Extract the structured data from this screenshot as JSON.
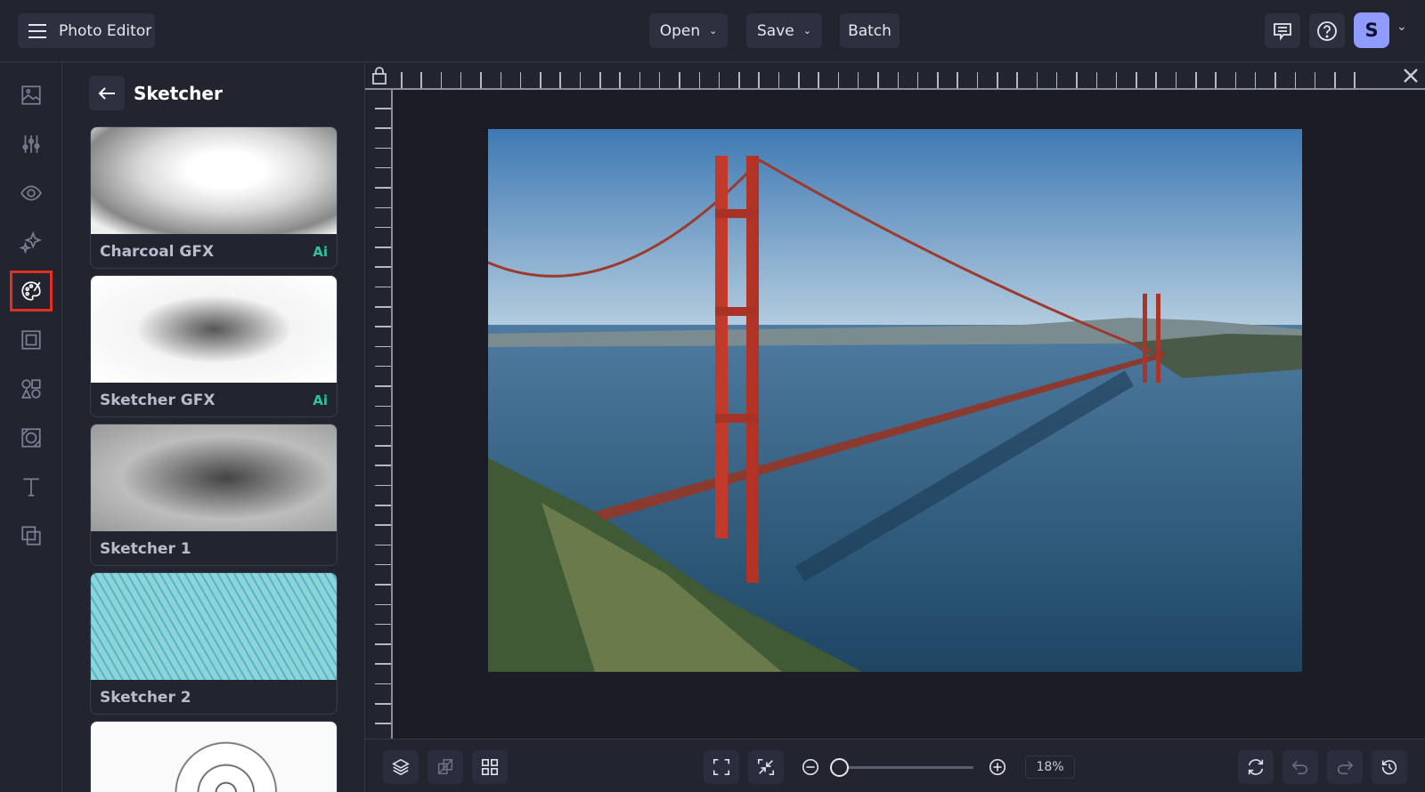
{
  "header": {
    "app_title": "Photo Editor",
    "open_label": "Open",
    "save_label": "Save",
    "batch_label": "Batch",
    "avatar_initial": "S"
  },
  "sidebar": {
    "items": [
      "image-icon",
      "adjust-icon",
      "eye-icon",
      "sparkle-icon",
      "palette-icon",
      "frame-icon",
      "shapes-icon",
      "texture-icon",
      "text-icon",
      "overlay-icon"
    ],
    "active": "palette-icon",
    "active_color": "#e0301e"
  },
  "panel": {
    "title": "Sketcher",
    "cards": [
      {
        "label": "Charcoal GFX",
        "badge": "Ai"
      },
      {
        "label": "Sketcher GFX",
        "badge": "Ai"
      },
      {
        "label": "Sketcher 1"
      },
      {
        "label": "Sketcher 2"
      },
      {
        "label": ""
      }
    ]
  },
  "footer": {
    "zoom": "18%",
    "zoom_slider_fraction": 0.0
  },
  "colors": {
    "accent_ai": "#2fc4a0",
    "avatar_bg": "#8f9bff"
  }
}
